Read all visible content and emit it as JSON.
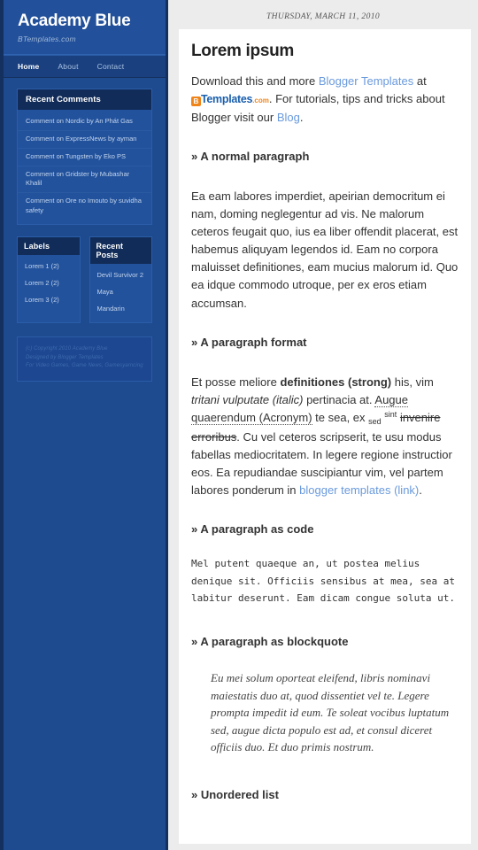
{
  "sidebar": {
    "blog_title": "Academy Blue",
    "tagline": "BTemplates.com",
    "nav": [
      {
        "label": "Home",
        "active": true
      },
      {
        "label": "About",
        "active": false
      },
      {
        "label": "Contact",
        "active": false
      }
    ],
    "recent_comments": {
      "title": "Recent Comments",
      "items": [
        "Comment on Nordic by An Phát Gas",
        "Comment on ExpressNews by ayman",
        "Comment on Tungsten by Eko PS",
        "Comment on Gridster by Mubashar Khalil",
        "Comment on Ore no Imouto by suvidha safety"
      ]
    },
    "labels": {
      "title": "Labels",
      "items": [
        "Lorem 1 (2)",
        "Lorem 2 (2)",
        "Lorem 3 (2)"
      ]
    },
    "recent_posts": {
      "title": "Recent Posts",
      "items": [
        "Devil Survivor 2",
        "Maya",
        "Mandarin"
      ]
    },
    "footer": {
      "line1": "(c) Copyright 2010 Academy Blue",
      "line2": "Designed by Blogger Templates",
      "line3": "For Video Games, Game News, Gamesyarncing"
    }
  },
  "main": {
    "date": "THURSDAY, MARCH 11, 2010",
    "post_title": "Lorem ipsum",
    "intro": {
      "t1": "Download this and more ",
      "link1": "Blogger Templates",
      "t2": " at ",
      "logo_badge": "B",
      "logo_name": "Templates",
      "logo_com": ".com",
      "t3": ". For tutorials, tips and tricks about Blogger visit our ",
      "link2": "Blog",
      "t4": "."
    },
    "sections": {
      "normal_paragraph": {
        "heading": "» A normal paragraph",
        "body": "Ea eam labores imperdiet, apeirian democritum ei nam, doming neglegentur ad vis. Ne malorum ceteros feugait quo, ius ea liber offendit placerat, est habemus aliquyam legendos id. Eam no corpora maluisset definitiones, eam mucius malorum id. Quo ea idque commodo utroque, per ex eros etiam accumsan."
      },
      "paragraph_format": {
        "heading": "» A paragraph format",
        "p1": "Et posse meliore ",
        "strong": "definitiones (strong)",
        "p2": " his, vim ",
        "italic": "tritani vulputate (italic)",
        "p3": " pertinacia at. ",
        "acronym": "Augue quaerendum (Acronym)",
        "p4": " te sea, ex ",
        "sub": "sed",
        "p5": " ",
        "sup": "sint",
        "p6": " ",
        "strike": "invenire erroribus",
        "p7": ". Cu vel ceteros scripserit, te usu modus fabellas mediocritatem. In legere regione instructior eos. Ea repudiandae suscipiantur vim, vel partem labores ponderum in ",
        "link": "blogger templates (link)",
        "p8": "."
      },
      "code": {
        "heading": "» A paragraph as code",
        "body": "Mel putent quaeque an, ut postea melius\ndenique sit. Officiis sensibus at mea, sea at\nlabitur deserunt. Eam dicam congue soluta ut."
      },
      "blockquote": {
        "heading": "» A paragraph as blockquote",
        "body": "Eu mei solum oporteat eleifend, libris nominavi maiestatis duo at, quod dissentiet vel te. Legere prompta impedit id eum. Te soleat vocibus luptatum sed, augue dicta populo est ad, et consul diceret officiis duo. Et duo primis nostrum."
      },
      "unordered_list": {
        "heading": "» Unordered list"
      }
    }
  },
  "colors": {
    "sidebar_bg": "#1e4a8f",
    "sidebar_dark": "#14305e",
    "widget_title_bg": "#112c58",
    "link_blue": "#6a9adc",
    "brand_orange": "#ef8419",
    "brand_blue": "#1a5fad"
  }
}
